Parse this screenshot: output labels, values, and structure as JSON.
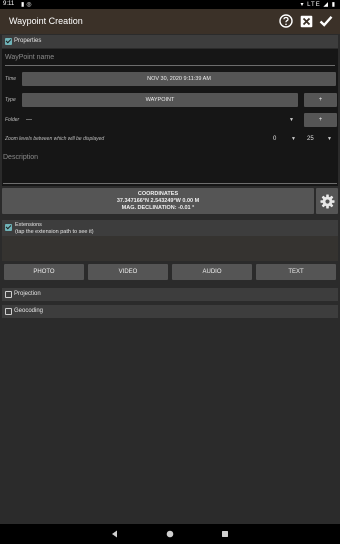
{
  "status_bar": {
    "time": "9:11",
    "icons": [
      "notification-icon",
      "at-sign-icon"
    ],
    "right": "LTE",
    "colors": {
      "background": "#000000"
    }
  },
  "app_bar": {
    "title": "Waypoint Creation",
    "actions": [
      "help-icon",
      "close-icon",
      "check-icon"
    ],
    "colors": {
      "background": "#3b3128"
    }
  },
  "properties": {
    "header_label": "Properties",
    "checked": true,
    "waypoint_name_placeholder": "WayPoint name",
    "time_label": "Time",
    "time_value": "NOV 30, 2020 9:11:39 AM",
    "type_label": "Type",
    "type_value": "WAYPOINT",
    "type_add": "+",
    "folder_label": "Folder",
    "folder_value": "---",
    "folder_add": "+",
    "zoom_label": "Zoom levels between which will be displayed",
    "zoom_min": "0",
    "zoom_max": "25",
    "description_placeholder": "Description"
  },
  "coordinates": {
    "title": "COORDINATES",
    "position": "37.347166°N 2.543249°W 0.00 M",
    "declination": "MAG. DECLINATION: -0.01 °"
  },
  "extensions": {
    "label": "Extensions",
    "hint": "(tap the extension path to see it)",
    "checked": true
  },
  "media_buttons": {
    "photo": "PHOTO",
    "video": "VIDEO",
    "audio": "AUDIO",
    "text": "TEXT"
  },
  "projection": {
    "label": "Projection",
    "checked": false
  },
  "geocoding": {
    "label": "Geocoding",
    "checked": false
  },
  "accent_color": "#6fb3b8"
}
